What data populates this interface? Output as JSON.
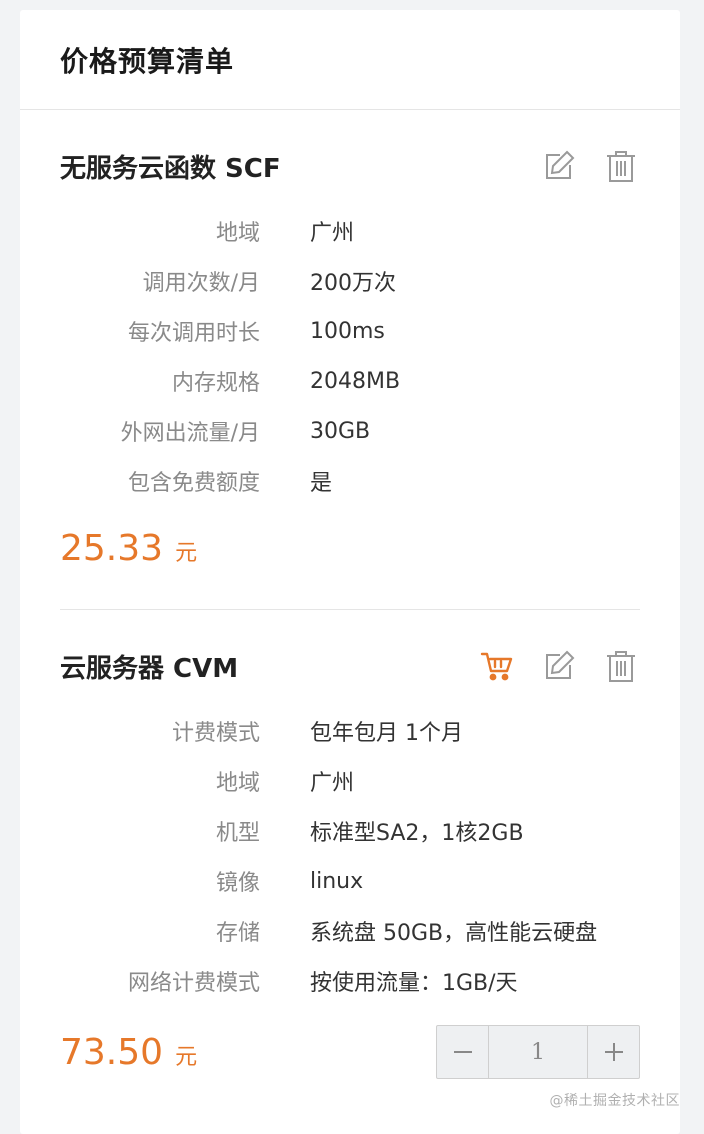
{
  "header": {
    "title": "价格预算清单"
  },
  "cards": [
    {
      "title": "无服务云函数 SCF",
      "rows": [
        {
          "label": "地域",
          "value": "广州"
        },
        {
          "label": "调用次数/月",
          "value": "200万次"
        },
        {
          "label": "每次调用时长",
          "value": "100ms"
        },
        {
          "label": "内存规格",
          "value": "2048MB"
        },
        {
          "label": "外网出流量/月",
          "value": "30GB"
        },
        {
          "label": "包含免费额度",
          "value": "是"
        }
      ],
      "price": "25.33",
      "unit": "元"
    },
    {
      "title": "云服务器 CVM",
      "rows": [
        {
          "label": "计费模式",
          "value": "包年包月 1个月"
        },
        {
          "label": "地域",
          "value": "广州"
        },
        {
          "label": "机型",
          "value": "标准型SA2，1核2GB"
        },
        {
          "label": "镜像",
          "value": "linux"
        },
        {
          "label": "存储",
          "value": "系统盘 50GB，高性能云硬盘"
        },
        {
          "label": "网络计费模式",
          "value": "按使用流量：1GB/天"
        }
      ],
      "price": "73.50",
      "unit": "元",
      "quantity": "1"
    }
  ],
  "icons": {
    "edit": "edit-icon",
    "delete": "trash-icon",
    "cart": "cart-icon",
    "minus": "minus-icon",
    "plus": "plus-icon"
  },
  "colors": {
    "accent": "#e6782a",
    "icon": "#9a9a9a"
  },
  "watermark": "@稀土掘金技术社区"
}
